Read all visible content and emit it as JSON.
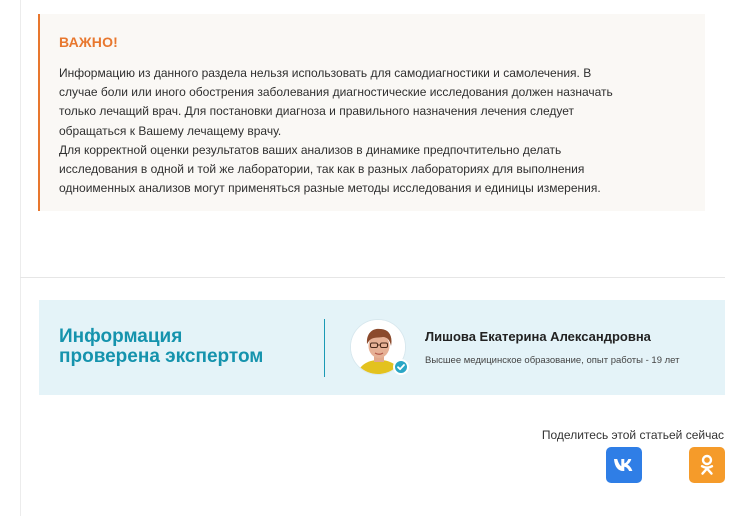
{
  "warning": {
    "title": "ВАЖНО!",
    "lines": [
      "Информацию из данного раздела нельзя использовать для самодиагностики и самолечения. В",
      "случае боли или иного обострения заболевания диагностические исследования должен назначать",
      "только лечащий врач. Для постановки диагноза и правильного назначения лечения следует",
      "обращаться к Вашему лечащему врачу.",
      "Для корректной оценки результатов ваших анализов в динамике предпочтительно делать",
      "исследования в одной и той же лаборатории, так как в разных лабораториях для выполнения",
      "одноименных анализов могут применяться разные методы исследования и единицы измерения."
    ]
  },
  "expert": {
    "heading_line1": "Информация",
    "heading_line2": "проверена экспертом",
    "name": "Лишова Екатерина Александровна",
    "description": "Высшее медицинское образование, опыт работы - 19 лет",
    "avatar_icon": "expert-photo",
    "verified_icon": "check-badge-icon"
  },
  "share": {
    "label": "Поделитесь этой статьей сейчас",
    "buttons": [
      {
        "icon": "vk-icon",
        "color": "#2f7ee6"
      },
      {
        "icon": "odnoklassniki-icon",
        "color": "#f59b2a"
      }
    ]
  },
  "colors": {
    "accent_orange": "#e8772e",
    "accent_teal": "#1593ad",
    "card_bg": "#e4f3f8"
  }
}
